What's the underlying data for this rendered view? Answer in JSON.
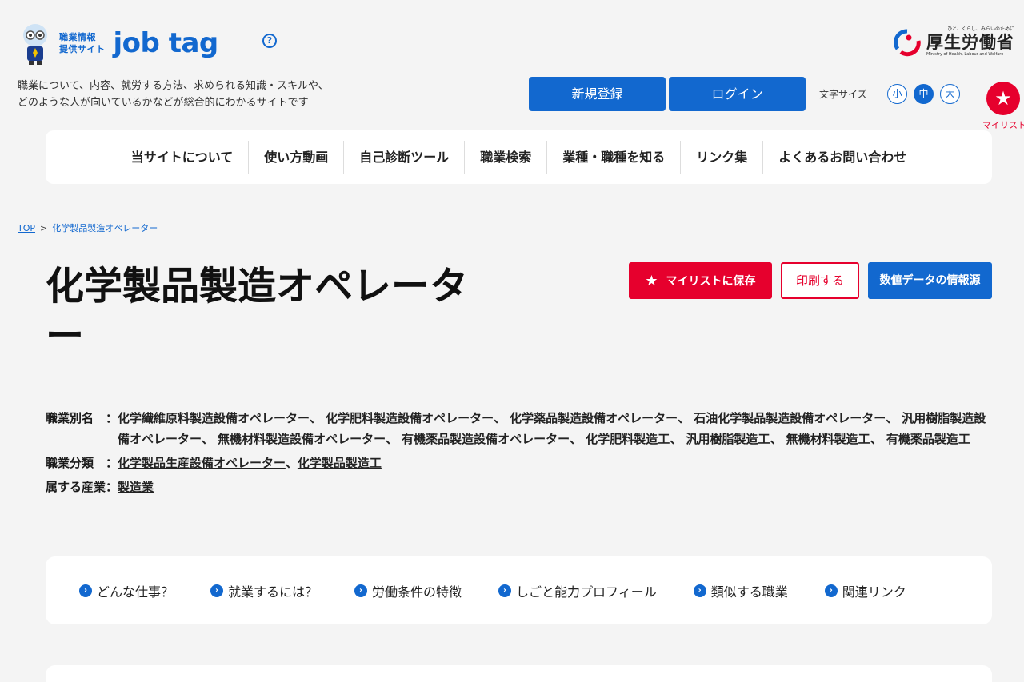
{
  "header": {
    "logo_small_line1": "職業情報",
    "logo_small_line2": "提供サイト",
    "logo_main": "job tag",
    "help_icon": "?",
    "tagline_line1": "職業について、内容、就労する方法、求められる知識・スキルや、",
    "tagline_line2": "どのような人が向いているかなどが総合的にわかるサイトです",
    "ministry_sub": "ひと、くらし、みらいのために",
    "ministry_name": "厚生労働省",
    "ministry_en": "Ministry of Health, Labour and Welfare",
    "register_label": "新規登録",
    "login_label": "ログイン",
    "fontsize_label": "文字サイズ",
    "fontsize_small": "小",
    "fontsize_medium": "中",
    "fontsize_large": "大",
    "mylist_label": "マイリスト"
  },
  "nav": {
    "items": [
      "当サイトについて",
      "使い方動画",
      "自己診断ツール",
      "職業検索",
      "業種・職種を知る",
      "リンク集",
      "よくあるお問い合わせ"
    ]
  },
  "breadcrumb": {
    "top": "TOP",
    "separator": ">",
    "current": "化学製品製造オペレーター"
  },
  "page": {
    "title": "化学製品製造オペレーター",
    "save_label": "マイリストに保存",
    "print_label": "印刷する",
    "data_label": "数値データの情報源"
  },
  "meta": {
    "alias_label": "職業別名　：",
    "alias_value": "化学繊維原料製造設備オペレーター、 化学肥料製造設備オペレーター、 化学薬品製造設備オペレーター、 石油化学製品製造設備オペレーター、 汎用樹脂製造設備オペレーター、 無機材料製造設備オペレーター、 有機薬品製造設備オペレーター、 化学肥料製造工、 汎用樹脂製造工、 無機材料製造工、 有機薬品製造工",
    "category_label": "職業分類　：",
    "category_link1": "化学製品生産設備オペレーター",
    "category_sep": "、",
    "category_link2": "化学製品製造工",
    "industry_label": "属する産業：",
    "industry_link": "製造業"
  },
  "anchor_nav": {
    "items": [
      "どんな仕事？",
      "就業するには？",
      "労働条件の特徴",
      "しごと能力プロフィール",
      "類似する職業",
      "関連リンク"
    ]
  },
  "colors": {
    "brand_blue": "#1268cf",
    "accent_red": "#e6002d",
    "background": "#f4f4f4"
  }
}
